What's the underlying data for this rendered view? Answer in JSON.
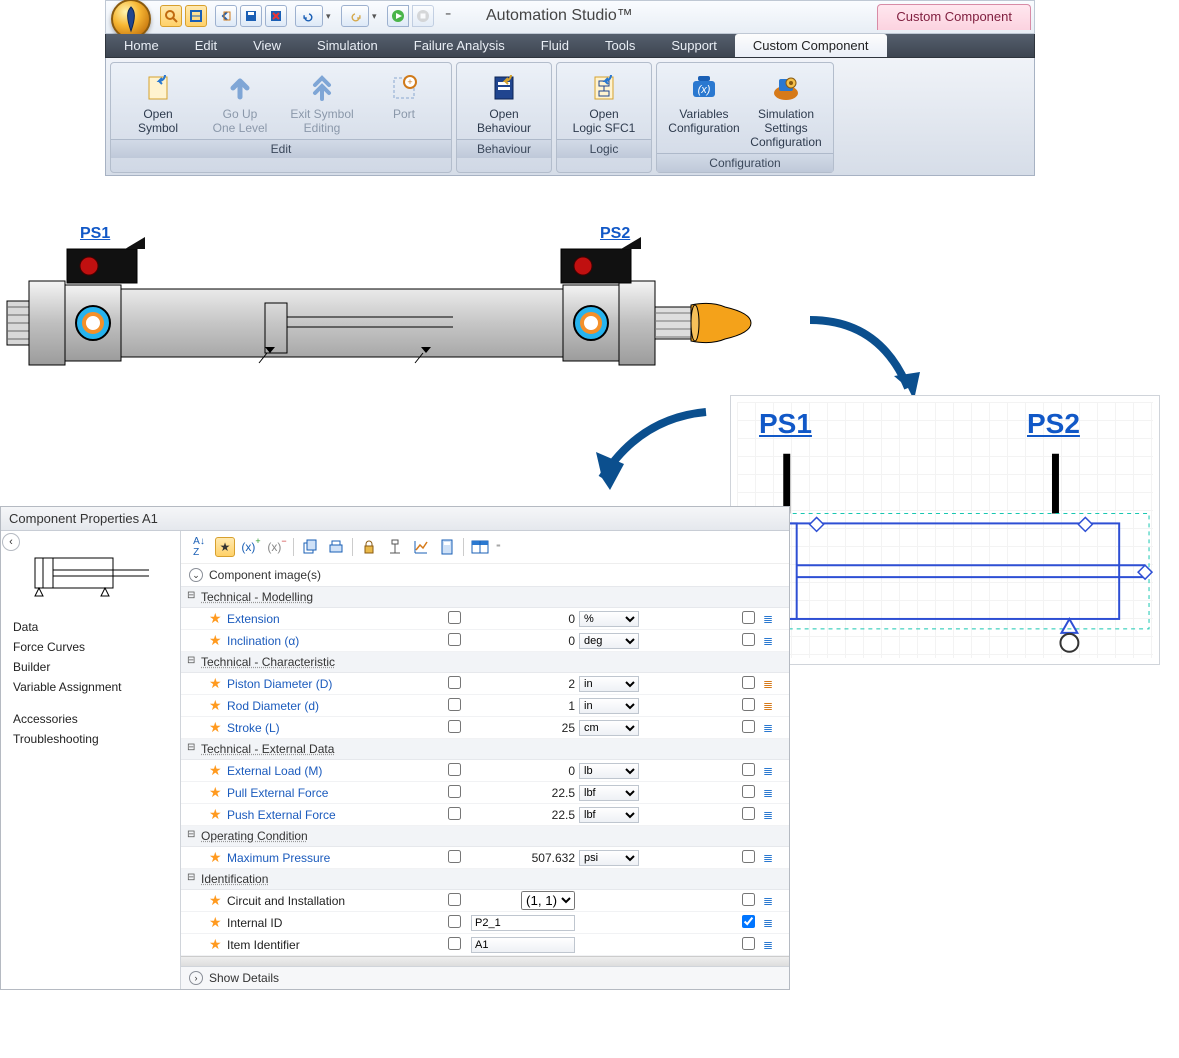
{
  "app_title": "Automation Studio™",
  "top_right_tab": "Custom Component",
  "menu_tabs": [
    "Home",
    "Edit",
    "View",
    "Simulation",
    "Failure Analysis",
    "Fluid",
    "Tools",
    "Support",
    "Custom Component"
  ],
  "menu_active_index": 8,
  "ribbon_groups": [
    {
      "title": "Edit",
      "buttons": [
        {
          "label": "Open\nSymbol",
          "icon": "doc-return",
          "disabled": false
        },
        {
          "label": "Go Up\nOne Level",
          "icon": "arrow-up",
          "disabled": true
        },
        {
          "label": "Exit Symbol\nEditing",
          "icon": "arrow-up-double",
          "disabled": true
        },
        {
          "label": "Port",
          "icon": "port",
          "disabled": true
        }
      ]
    },
    {
      "title": "Behaviour",
      "buttons": [
        {
          "label": "Open\nBehaviour",
          "icon": "doc-return-dark",
          "disabled": false
        }
      ]
    },
    {
      "title": "Logic",
      "buttons": [
        {
          "label": "Open\nLogic SFC1",
          "icon": "doc-sfc",
          "disabled": false
        }
      ]
    },
    {
      "title": "Configuration",
      "buttons": [
        {
          "label": "Variables\nConfiguration",
          "icon": "var-config",
          "disabled": false
        },
        {
          "label": "Simulation Settings\nConfiguration",
          "icon": "sim-config",
          "disabled": false
        }
      ]
    }
  ],
  "sensor_labels": {
    "ps1": "PS1",
    "ps2": "PS2"
  },
  "schematic_labels": {
    "ps1": "PS1",
    "ps2": "PS2"
  },
  "properties_panel": {
    "title": "Component Properties A1",
    "section_label": "Component image(s)",
    "footer_label": "Show Details",
    "side_nav": [
      "Data",
      "Force Curves",
      "Builder",
      "Variable Assignment",
      "",
      "Accessories",
      "Troubleshooting"
    ],
    "categories": [
      {
        "name": "Technical - Modelling",
        "rows": [
          {
            "name": "Extension",
            "value": "0",
            "unit": "%",
            "link": true
          },
          {
            "name": "Inclination (α)",
            "value": "0",
            "unit": "deg",
            "link": true
          }
        ]
      },
      {
        "name": "Technical - Characteristic",
        "rows": [
          {
            "name": "Piston Diameter (D)",
            "value": "2",
            "unit": "in",
            "link": true,
            "iconColor": "#d67a1a"
          },
          {
            "name": "Rod Diameter (d)",
            "value": "1",
            "unit": "in",
            "link": true,
            "iconColor": "#d67a1a"
          },
          {
            "name": "Stroke (L)",
            "value": "25",
            "unit": "cm",
            "link": true
          }
        ]
      },
      {
        "name": "Technical - External Data",
        "rows": [
          {
            "name": "External Load (M)",
            "value": "0",
            "unit": "lb",
            "link": true
          },
          {
            "name": "Pull External Force",
            "value": "22.5",
            "unit": "lbf",
            "link": true
          },
          {
            "name": "Push External Force",
            "value": "22.5",
            "unit": "lbf",
            "link": true
          }
        ]
      },
      {
        "name": "Operating Condition",
        "rows": [
          {
            "name": "Maximum Pressure",
            "value": "507.632",
            "unit": "psi",
            "link": true
          }
        ]
      },
      {
        "name": "Identification",
        "rows": [
          {
            "name": "Circuit and Installation",
            "valueType": "dropdown",
            "value": "(1, 1)",
            "link": false
          },
          {
            "name": "Internal ID",
            "valueType": "text",
            "value": "P2_1",
            "link": false,
            "checked2": true
          },
          {
            "name": "Item Identifier",
            "valueType": "text-dd",
            "value": "A1",
            "link": false
          }
        ]
      }
    ]
  }
}
